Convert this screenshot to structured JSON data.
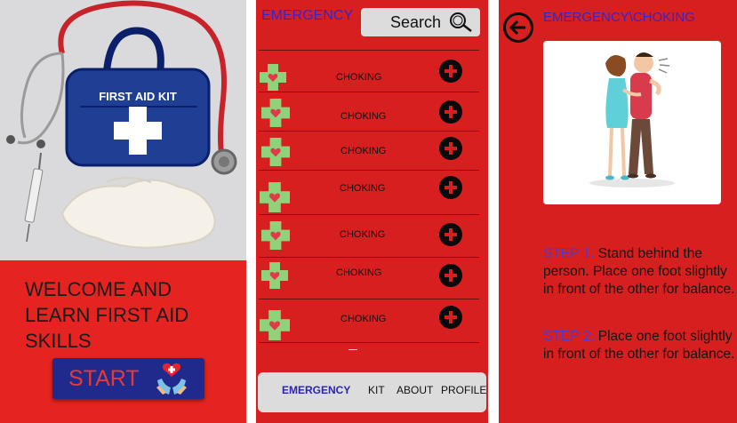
{
  "welcome_screen": {
    "image_text": "FIRST AID KIT",
    "welcome_text": "WELCOME AND LEARN FIRST AID SKILLS",
    "start_label": "START"
  },
  "list_screen": {
    "title": "EMERGENCY",
    "search_label": "Search",
    "items": [
      {
        "label": "CHOKING"
      },
      {
        "label": "CHOKING"
      },
      {
        "label": "CHOKING"
      },
      {
        "label": "CHOKING"
      },
      {
        "label": "CHOKING"
      },
      {
        "label": "CHOKING"
      },
      {
        "label": "CHOKING"
      }
    ],
    "nav": {
      "emergency": "EMERGENCY",
      "kit": "KIT",
      "about": "ABOUT",
      "profile": "PROFILE"
    }
  },
  "detail_screen": {
    "title": "EMERGENCY\\CHOKING",
    "steps": [
      {
        "num": "STEP 1.",
        "text": "Stand behind the person. Place one foot slightly in front of the other for balance."
      },
      {
        "num": "STEP 2.",
        "text": "Place one foot slightly in front of the other for balance."
      }
    ]
  },
  "colors": {
    "primary_red": "#d71f1f",
    "welcome_red": "#e52421",
    "title_blue": "#3a23c8",
    "start_button": "#202a8c",
    "kit_icon_green": "#8fd27a"
  }
}
